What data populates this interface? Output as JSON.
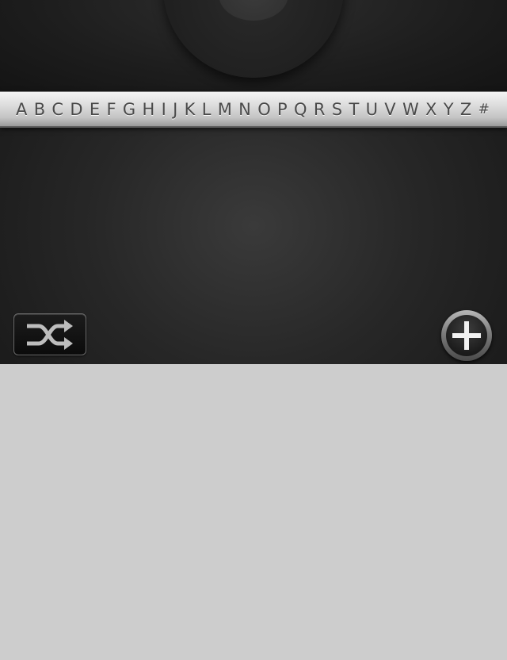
{
  "alphabet_index": [
    "A",
    "B",
    "C",
    "D",
    "E",
    "F",
    "G",
    "H",
    "I",
    "J",
    "K",
    "L",
    "M",
    "N",
    "O",
    "P",
    "Q",
    "R",
    "S",
    "T",
    "U",
    "V",
    "W",
    "X",
    "Y",
    "Z",
    "#"
  ],
  "icons": {
    "wheel": "disc-wheel-icon",
    "shuffle": "shuffle-icon",
    "add": "plus-circle-icon"
  },
  "colors": {
    "background_dark": "#272727",
    "index_bar": "#d8d8d8",
    "index_text": "#4a4a4a",
    "lower_area": "#cdcdcd"
  }
}
